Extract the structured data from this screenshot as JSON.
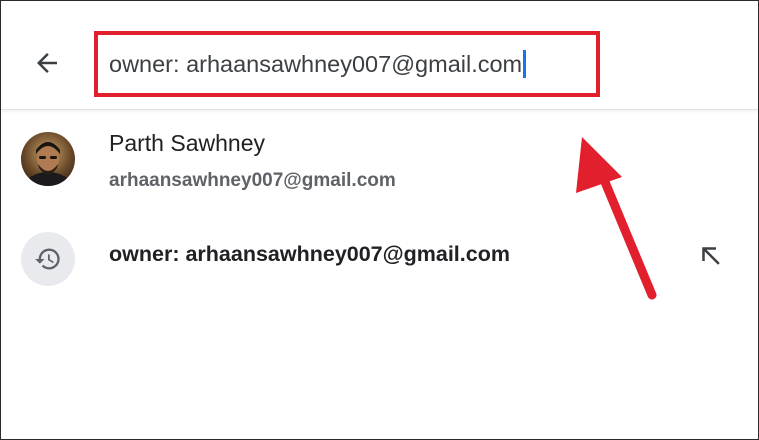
{
  "search": {
    "value": "owner: arhaansawhney007@gmail.com"
  },
  "suggestions": {
    "contact": {
      "name": "Parth Sawhney",
      "email": "arhaansawhney007@gmail.com"
    },
    "history": {
      "label": "owner: arhaansawhney007@gmail.com"
    }
  },
  "icons": {
    "back": "arrow-left-icon",
    "history": "history-icon",
    "fill": "arrow-up-left-icon"
  },
  "colors": {
    "highlight": "#e2202d",
    "caret": "#1a73e8",
    "text_primary": "#202124",
    "text_secondary": "#5f6368"
  }
}
